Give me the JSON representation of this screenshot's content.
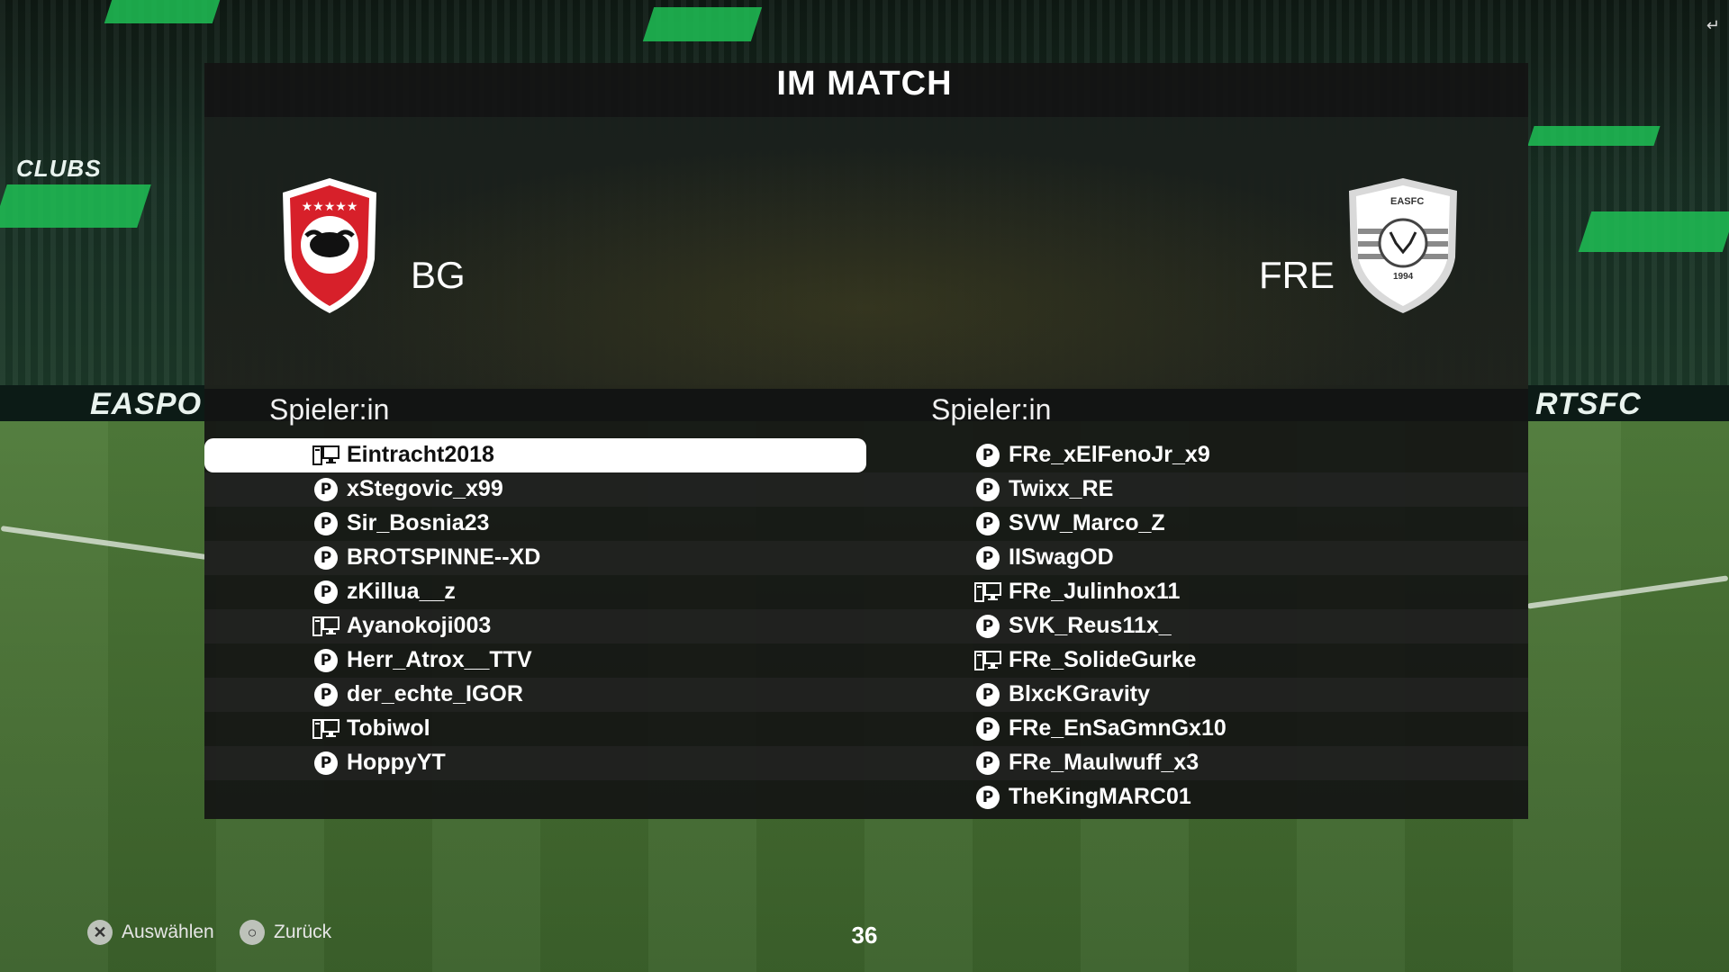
{
  "header": {
    "title": "IM MATCH"
  },
  "teams": {
    "home": {
      "abbr": "BG"
    },
    "away": {
      "abbr": "FRE",
      "crest_text_top": "EASFC",
      "crest_text_bottom": "1994"
    }
  },
  "columns": {
    "left_heading": "Spieler:in",
    "right_heading": "Spieler:in"
  },
  "home_players": [
    {
      "name": "Eintracht2018",
      "platform": "pc-icon",
      "selected": true
    },
    {
      "name": "xStegovic_x99",
      "platform": "playstation-icon"
    },
    {
      "name": "Sir_Bosnia23",
      "platform": "playstation-icon"
    },
    {
      "name": "BROTSPINNE--XD",
      "platform": "playstation-icon"
    },
    {
      "name": "zKillua__z",
      "platform": "playstation-icon"
    },
    {
      "name": "Ayanokoji003",
      "platform": "pc-icon"
    },
    {
      "name": "Herr_Atrox__TTV",
      "platform": "playstation-icon"
    },
    {
      "name": "der_echte_IGOR",
      "platform": "playstation-icon"
    },
    {
      "name": "Tobiwol",
      "platform": "pc-icon"
    },
    {
      "name": "HoppyYT",
      "platform": "playstation-icon"
    }
  ],
  "away_players": [
    {
      "name": "FRe_xElFenoJr_x9",
      "platform": "playstation-icon"
    },
    {
      "name": "Twixx_RE",
      "platform": "playstation-icon"
    },
    {
      "name": "SVW_Marco_Z",
      "platform": "playstation-icon"
    },
    {
      "name": "IISwagOD",
      "platform": "playstation-icon"
    },
    {
      "name": "FRe_Julinhox11",
      "platform": "pc-icon"
    },
    {
      "name": "SVK_Reus11x_",
      "platform": "playstation-icon"
    },
    {
      "name": "FRe_SolideGurke",
      "platform": "pc-icon"
    },
    {
      "name": "BlxcKGravity",
      "platform": "playstation-icon"
    },
    {
      "name": "FRe_EnSaGmnGx10",
      "platform": "playstation-icon"
    },
    {
      "name": "FRe_Maulwuff_x3",
      "platform": "playstation-icon"
    },
    {
      "name": "TheKingMARC01",
      "platform": "playstation-icon"
    }
  ],
  "footer": {
    "select_label": "Auswählen",
    "back_label": "Zurück",
    "timer": "36"
  },
  "stadium_boards": [
    "EASPO",
    "RTSFC",
    "CLUBS"
  ],
  "colors": {
    "accent_green": "#1fbf55",
    "home_crest_red": "#d7202a",
    "panel": "#141414"
  }
}
